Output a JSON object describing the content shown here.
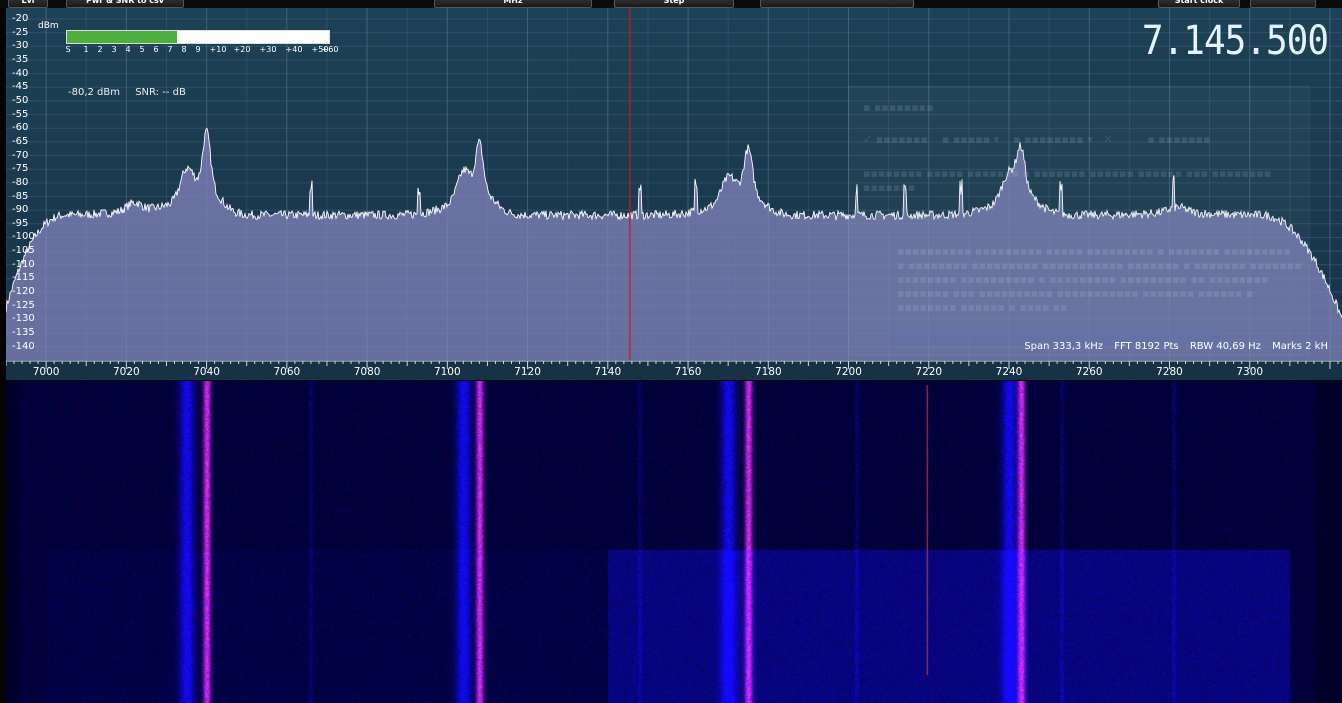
{
  "top_bar": {
    "buttons": [
      "Lvl",
      "Pwr & SNR to csv",
      "MHz",
      "Step",
      "Start clock"
    ]
  },
  "meter": {
    "unit": "dBm",
    "scale_labels": [
      "S",
      "1",
      "2",
      "3",
      "4",
      "5",
      "6",
      "7",
      "8",
      "9",
      "+10",
      "+20",
      "+30",
      "+40",
      "+50",
      "+60"
    ],
    "level_fraction": 0.42,
    "level_dbm": "-80,2 dBm",
    "snr": "SNR: -- dB"
  },
  "frequency_display": "7.145.500",
  "spectrum": {
    "db_ticks": [
      "-20",
      "-25",
      "-30",
      "-35",
      "-40",
      "-45",
      "-50",
      "-55",
      "-60",
      "-65",
      "-70",
      "-75",
      "-80",
      "-85",
      "-90",
      "-95",
      "-100",
      "-105",
      "-110",
      "-115",
      "-120",
      "-125",
      "-130",
      "-135",
      "-140"
    ],
    "freq_ticks": [
      "7000",
      "7020",
      "7040",
      "7060",
      "7080",
      "7100",
      "7120",
      "7140",
      "7160",
      "7180",
      "7200",
      "7220",
      "7240",
      "7260",
      "7280",
      "7300"
    ],
    "freq_range_khz": [
      6990,
      7323
    ],
    "db_range": [
      -20,
      -143
    ],
    "noise_floor_db": -93,
    "peaks_khz": [
      7035,
      7040,
      7104,
      7108,
      7170,
      7175,
      7240,
      7243
    ],
    "marker_khz": 7145.5,
    "colors": {
      "background": "#1c3e53",
      "fill": "#8686c0",
      "trace": "#ffffff",
      "marker": "#d01818",
      "grid": "#5c7c96"
    }
  },
  "status": {
    "span": "Span 333,3 kHz",
    "fft": "FFT 8192 Pts",
    "rbw": "RBW 40,69 Hz",
    "marks": "Marks 2 kH"
  },
  "waterfall": {
    "signals_khz": [
      7035,
      7040,
      7104,
      7108,
      7170,
      7175,
      7240,
      7243
    ],
    "colors": {
      "signal": "#6a3cff",
      "hot": "#ff5cff",
      "noise": "#2a24a8"
    }
  }
}
